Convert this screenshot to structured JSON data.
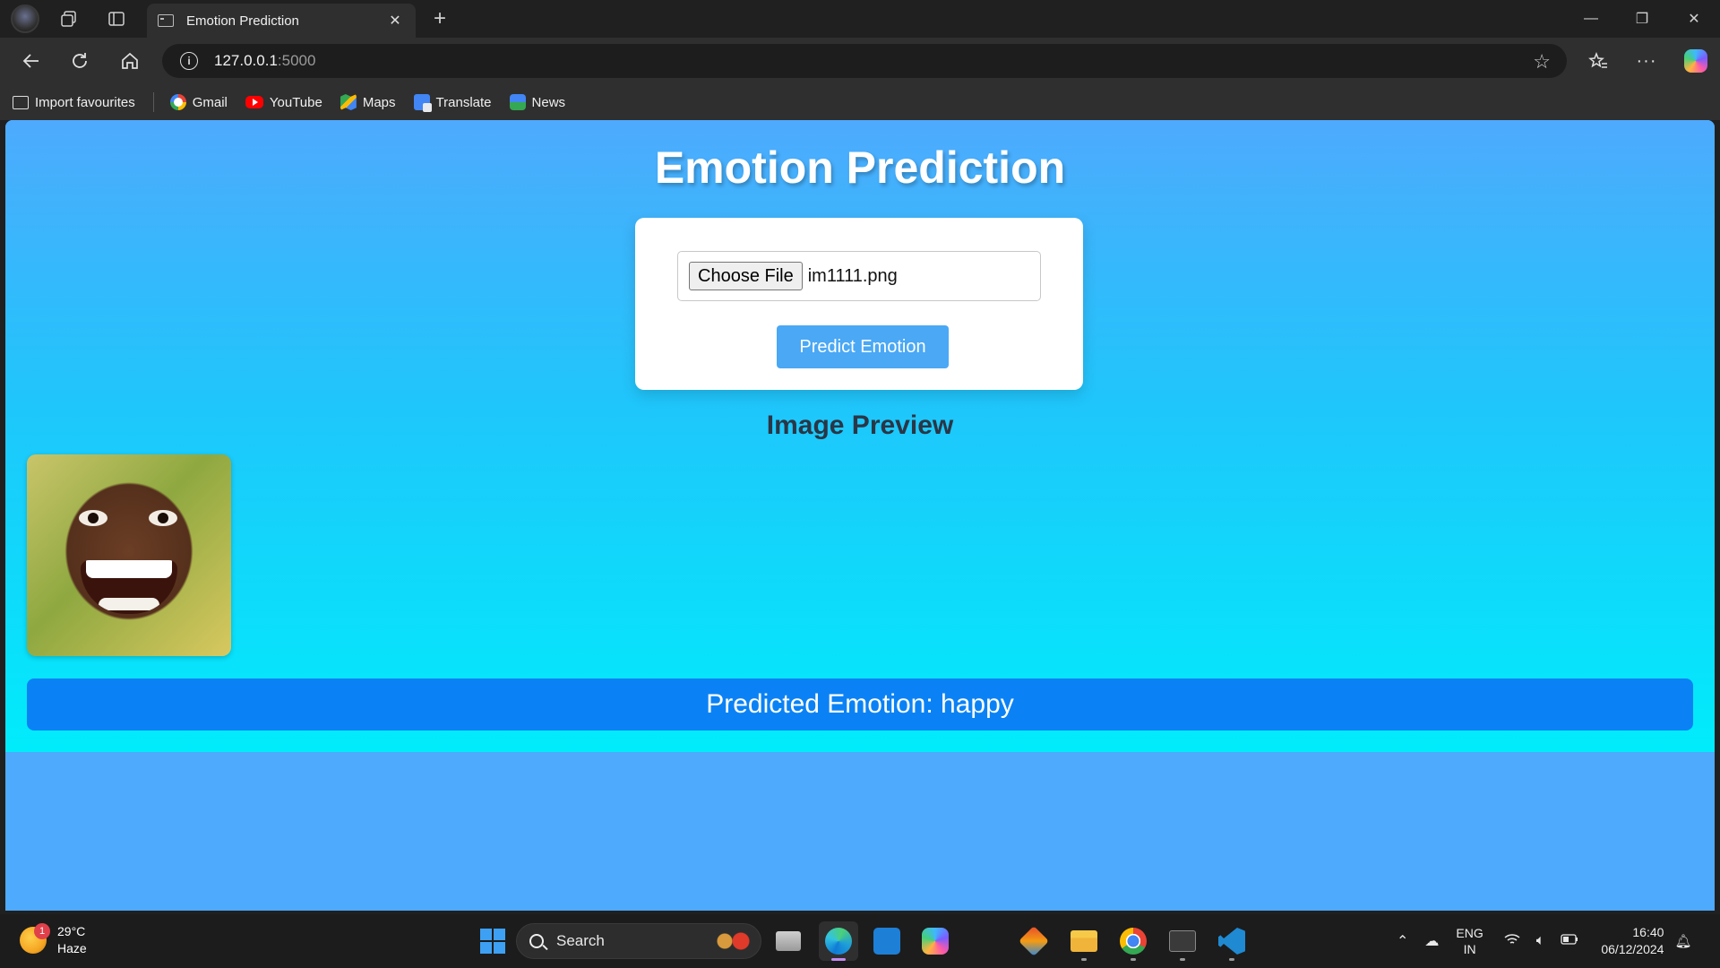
{
  "browser": {
    "tab_title": "Emotion Prediction",
    "tab_close": "✕",
    "new_tab": "+",
    "url_host": "127.0.0.1",
    "url_port": ":5000",
    "window_controls": {
      "minimize": "—",
      "restore": "❐",
      "close": "✕"
    }
  },
  "bookmarks": [
    {
      "label": "Import favourites",
      "icon": "import-icon"
    },
    {
      "label": "Gmail",
      "icon": "google-icon"
    },
    {
      "label": "YouTube",
      "icon": "youtube-icon"
    },
    {
      "label": "Maps",
      "icon": "maps-icon"
    },
    {
      "label": "Translate",
      "icon": "translate-icon"
    },
    {
      "label": "News",
      "icon": "news-icon"
    }
  ],
  "page": {
    "title": "Emotion Prediction",
    "choose_file_label": "Choose File",
    "file_name": "im1111.png",
    "predict_button": "Predict Emotion",
    "preview_heading": "Image Preview",
    "result": "Predicted Emotion: happy"
  },
  "taskbar": {
    "weather_temp": "29°C",
    "weather_desc": "Haze",
    "weather_badge": "1",
    "search_label": "Search",
    "lang_line1": "ENG",
    "lang_line2": "IN",
    "time": "16:40",
    "date": "06/12/2024"
  },
  "colors": {
    "page_bg_top": "#4eaafd",
    "page_bg_bottom": "#00ecfb",
    "result_banner": "#0a82f5",
    "predict_button": "#4aa8f5"
  }
}
